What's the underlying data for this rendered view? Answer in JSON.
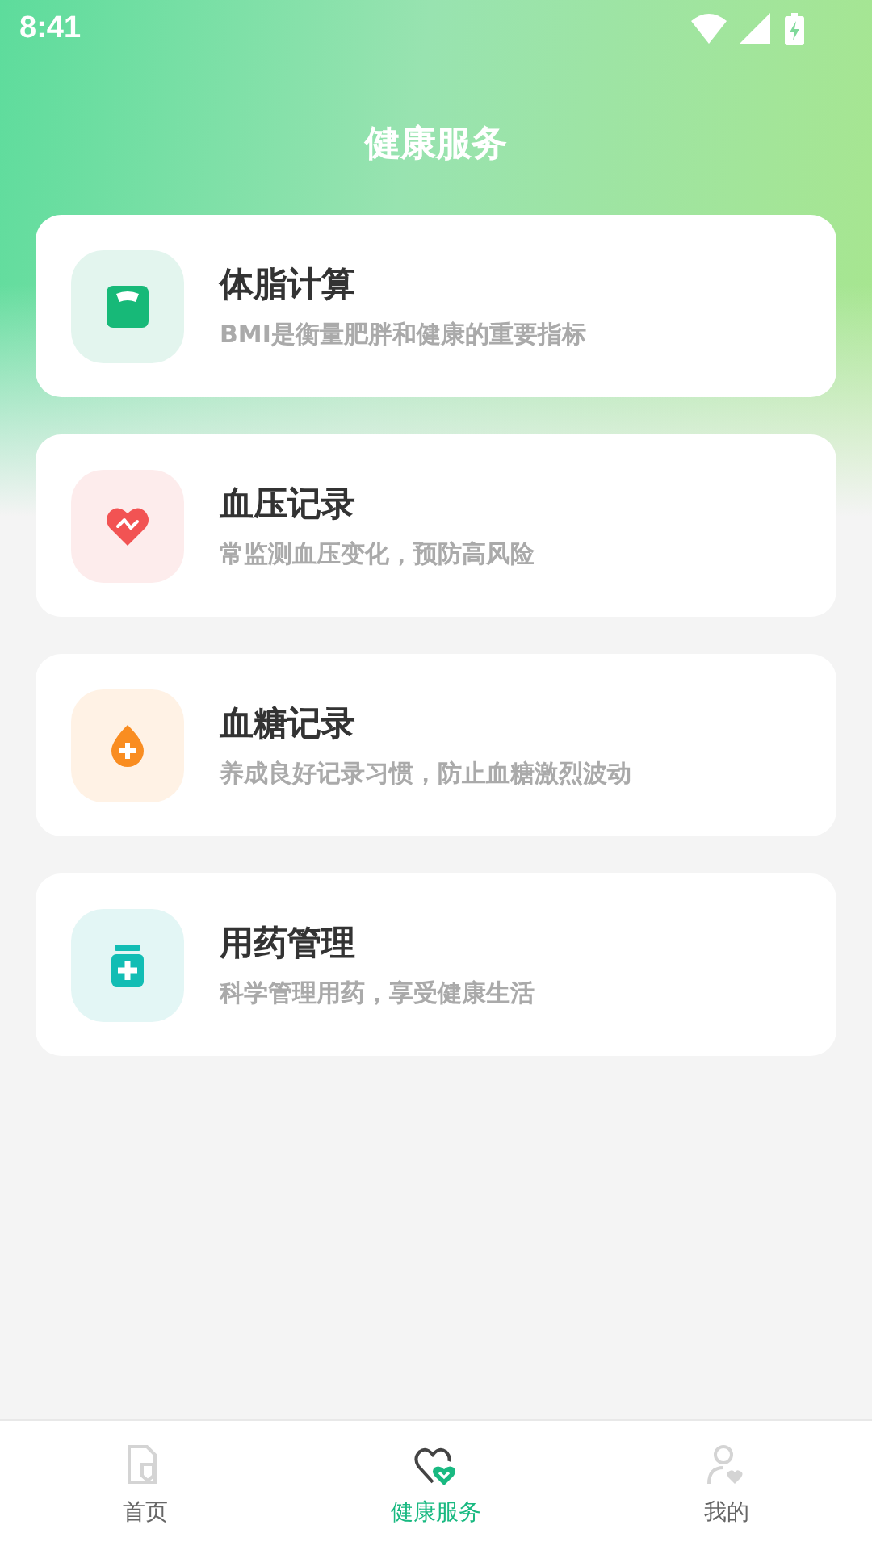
{
  "status_bar": {
    "time": "8:41"
  },
  "title": "健康服务",
  "services": [
    {
      "kind": "scale",
      "title": "体脂计算",
      "subtitle": "BMI是衡量肥胖和健康的重要指标"
    },
    {
      "kind": "heart",
      "title": "血压记录",
      "subtitle": "常监测血压变化，预防高风险"
    },
    {
      "kind": "drop",
      "title": "血糖记录",
      "subtitle": "养成良好记录习惯，防止血糖激烈波动"
    },
    {
      "kind": "bottle",
      "title": "用药管理",
      "subtitle": "科学管理用药，享受健康生活"
    }
  ],
  "tabs": [
    {
      "kind": "home",
      "label": "首页",
      "selected": false
    },
    {
      "kind": "health",
      "label": "健康服务",
      "selected": true
    },
    {
      "kind": "profile",
      "label": "我的",
      "selected": false
    }
  ]
}
